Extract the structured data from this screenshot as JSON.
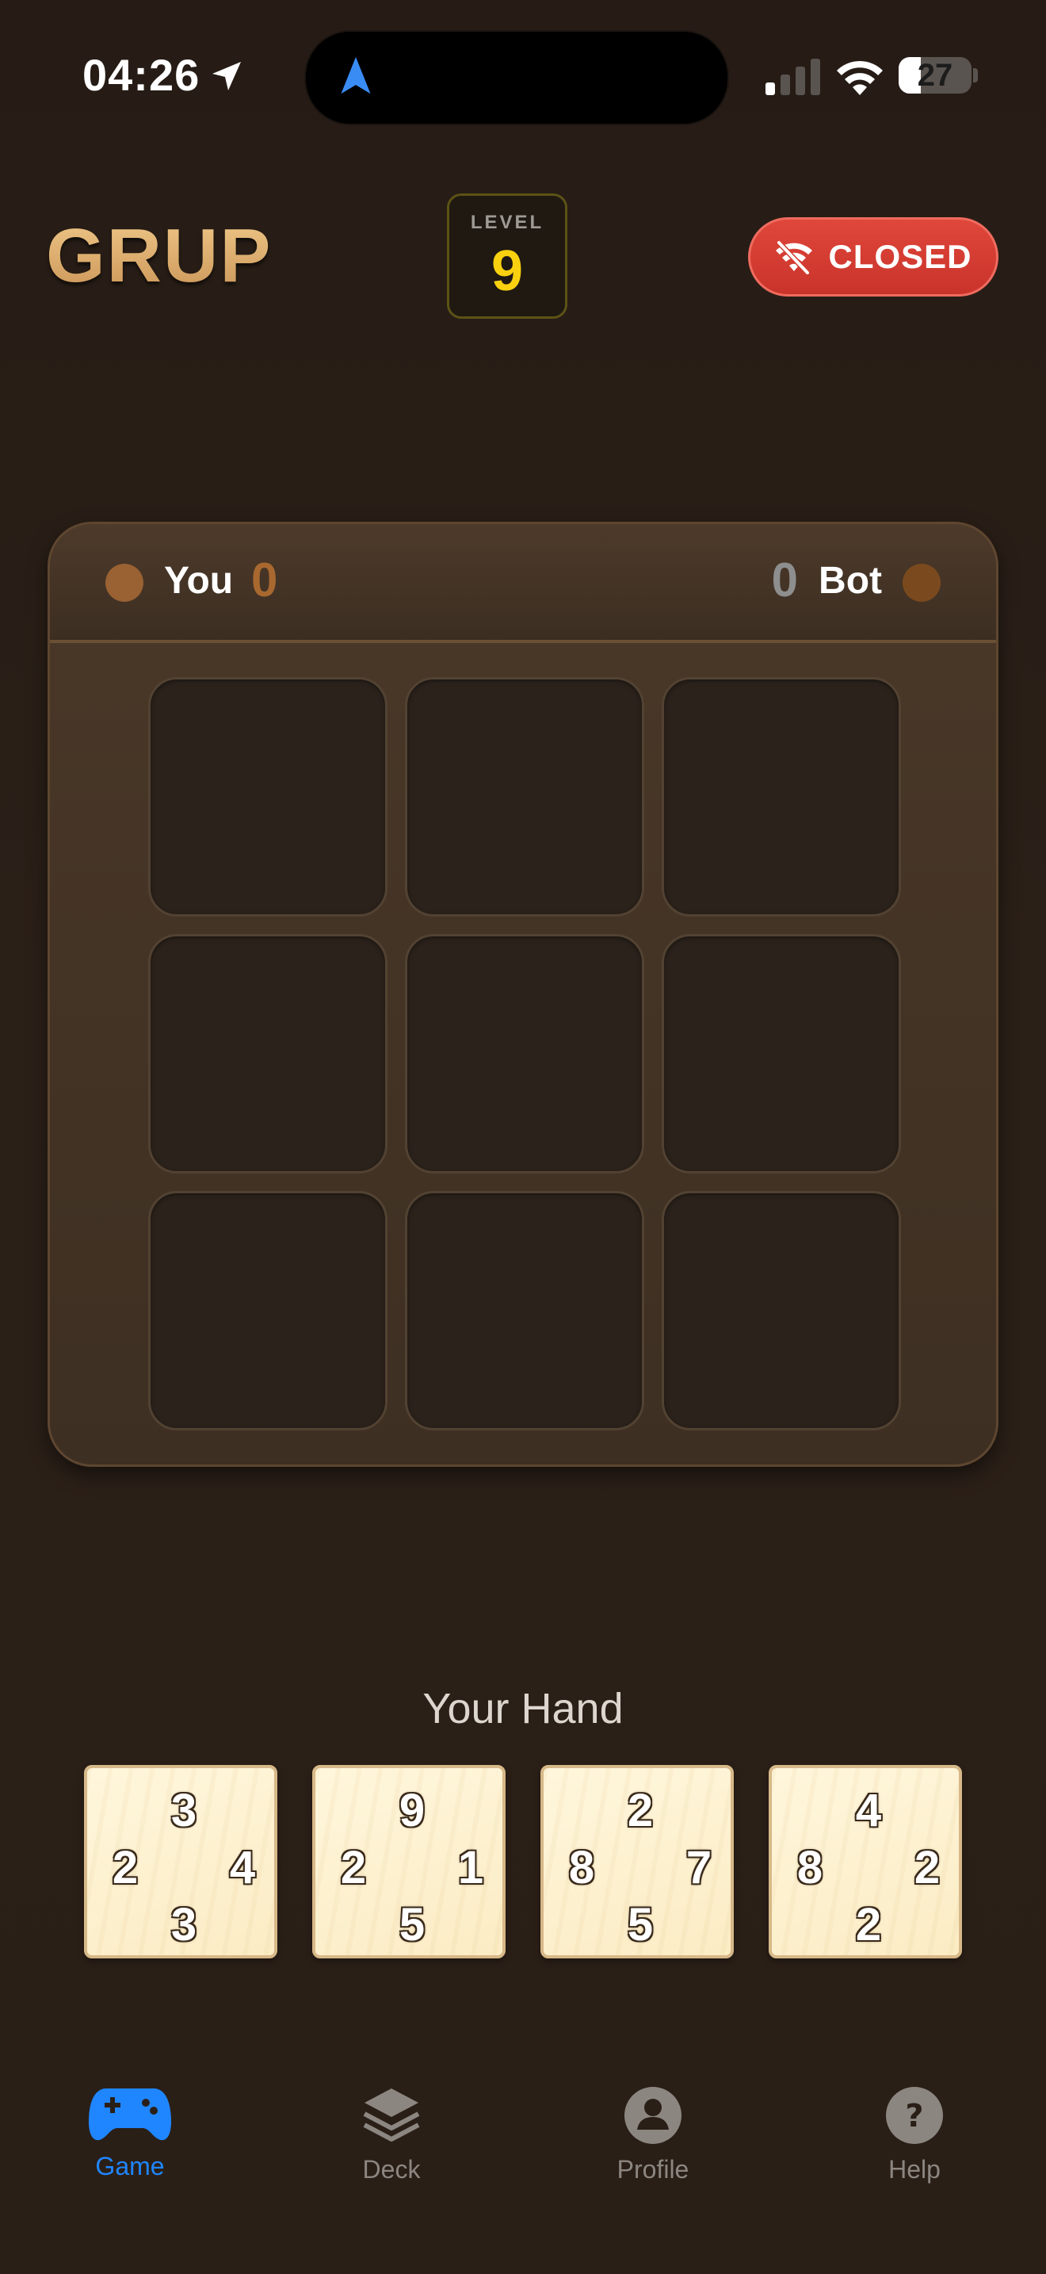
{
  "status_bar": {
    "time": "04:26",
    "battery": "27"
  },
  "header": {
    "title": "GRUP",
    "level_label": "LEVEL",
    "level_value": "9",
    "connection_label": "CLOSED"
  },
  "scoreboard": {
    "player_name": "You",
    "player_score": "0",
    "bot_name": "Bot",
    "bot_score": "0"
  },
  "board": {
    "rows": 3,
    "cols": 3,
    "cells": [
      "",
      "",
      "",
      "",
      "",
      "",
      "",
      "",
      ""
    ]
  },
  "hand": {
    "title": "Your Hand",
    "cards": [
      {
        "top": "3",
        "left": "2",
        "right": "4",
        "bottom": "3"
      },
      {
        "top": "9",
        "left": "2",
        "right": "1",
        "bottom": "5"
      },
      {
        "top": "2",
        "left": "8",
        "right": "7",
        "bottom": "5"
      },
      {
        "top": "4",
        "left": "8",
        "right": "2",
        "bottom": "2"
      }
    ]
  },
  "tab_bar": {
    "tabs": [
      {
        "label": "Game",
        "icon": "gamepad-icon",
        "active": true
      },
      {
        "label": "Deck",
        "icon": "stack-icon",
        "active": false
      },
      {
        "label": "Profile",
        "icon": "person-icon",
        "active": false
      },
      {
        "label": "Help",
        "icon": "question-icon",
        "active": false
      }
    ]
  },
  "colors": {
    "accent": "#1f86ff",
    "level_value": "#f9d10f",
    "closed_button": "#d33c31",
    "title_gold": "#e0b06e"
  }
}
